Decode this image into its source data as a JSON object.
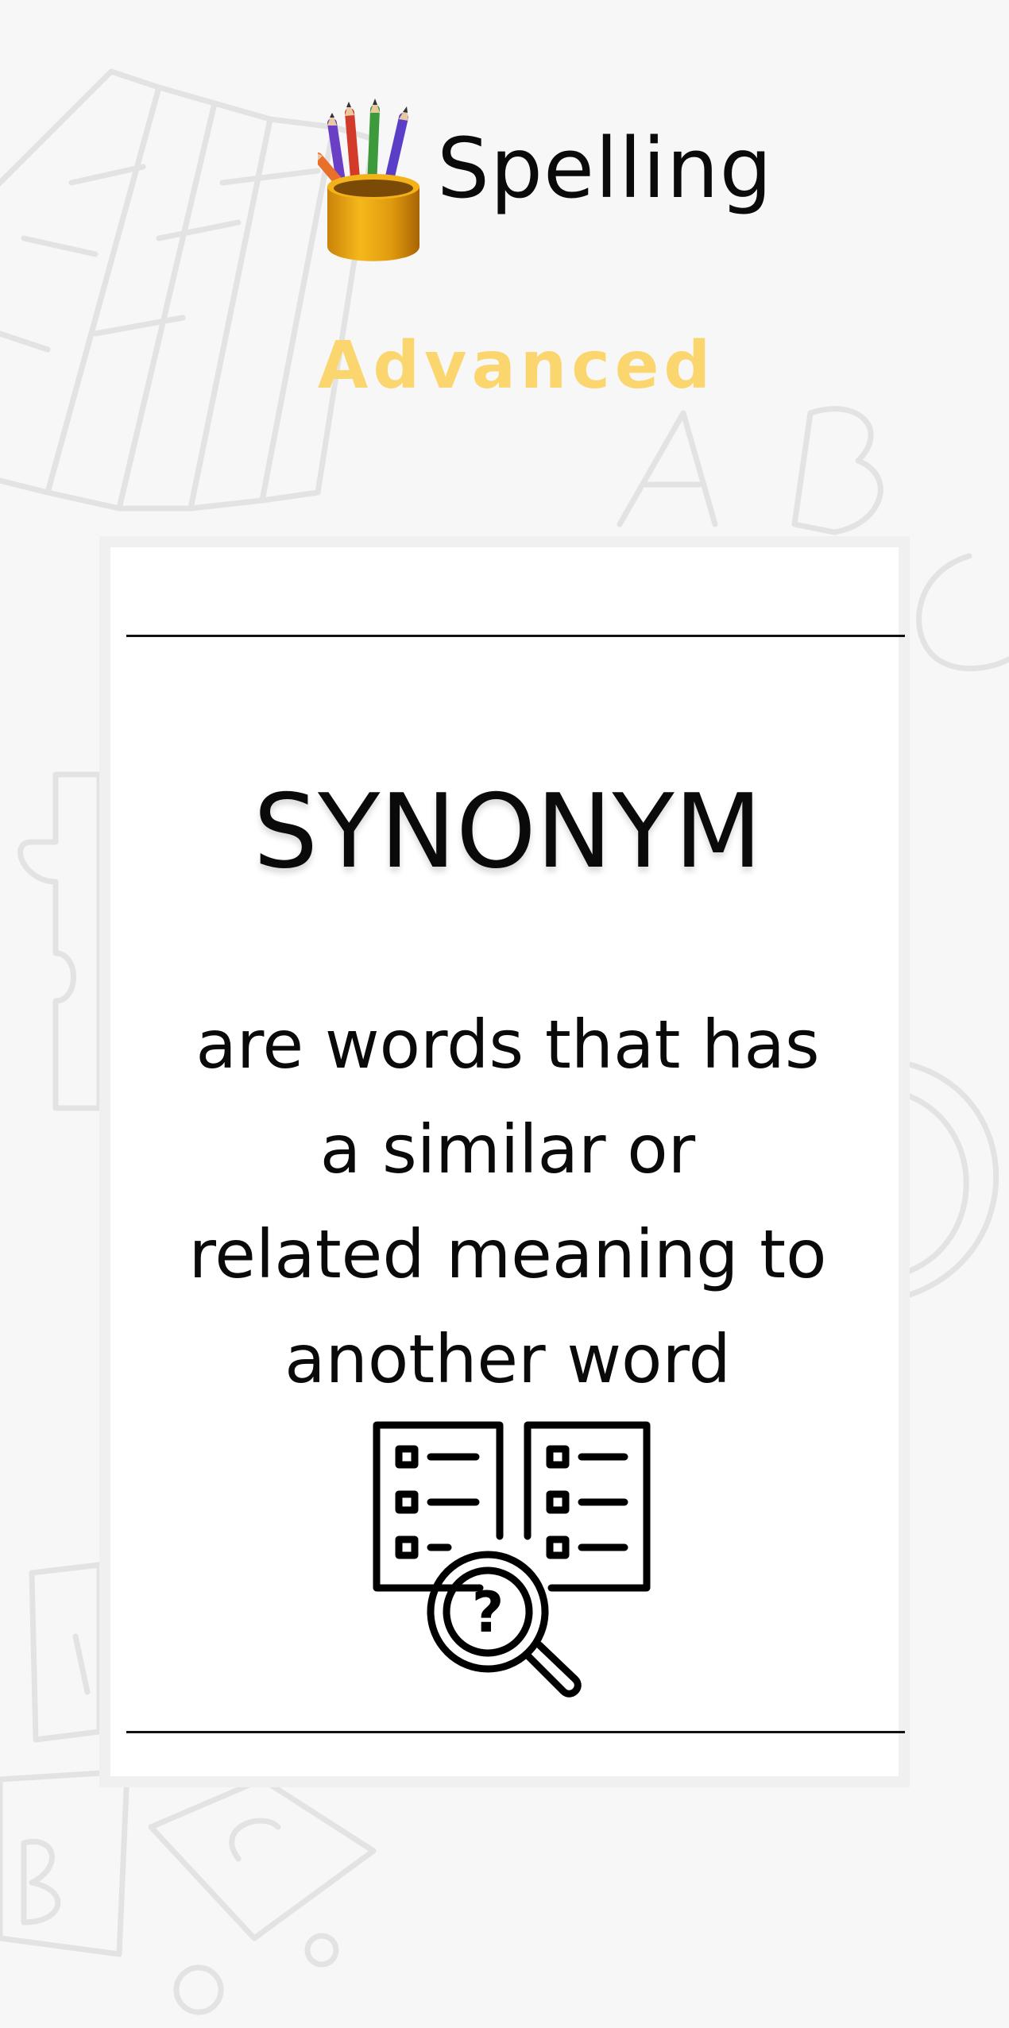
{
  "header": {
    "logo_icon": "pencil-cup-icon",
    "title": "Spelling",
    "level": "Advanced"
  },
  "card": {
    "term": "SYNONYM",
    "definition_lines": [
      "are words that has",
      "a similar or",
      "related meaning to",
      "another word"
    ],
    "illustration_icon": "documents-search-question-icon"
  },
  "colors": {
    "background": "#f7f7f7",
    "card": "#ffffff",
    "accent": "#fbd66f",
    "text": "#0a0a0a",
    "doodle": "#e3e3e3"
  }
}
